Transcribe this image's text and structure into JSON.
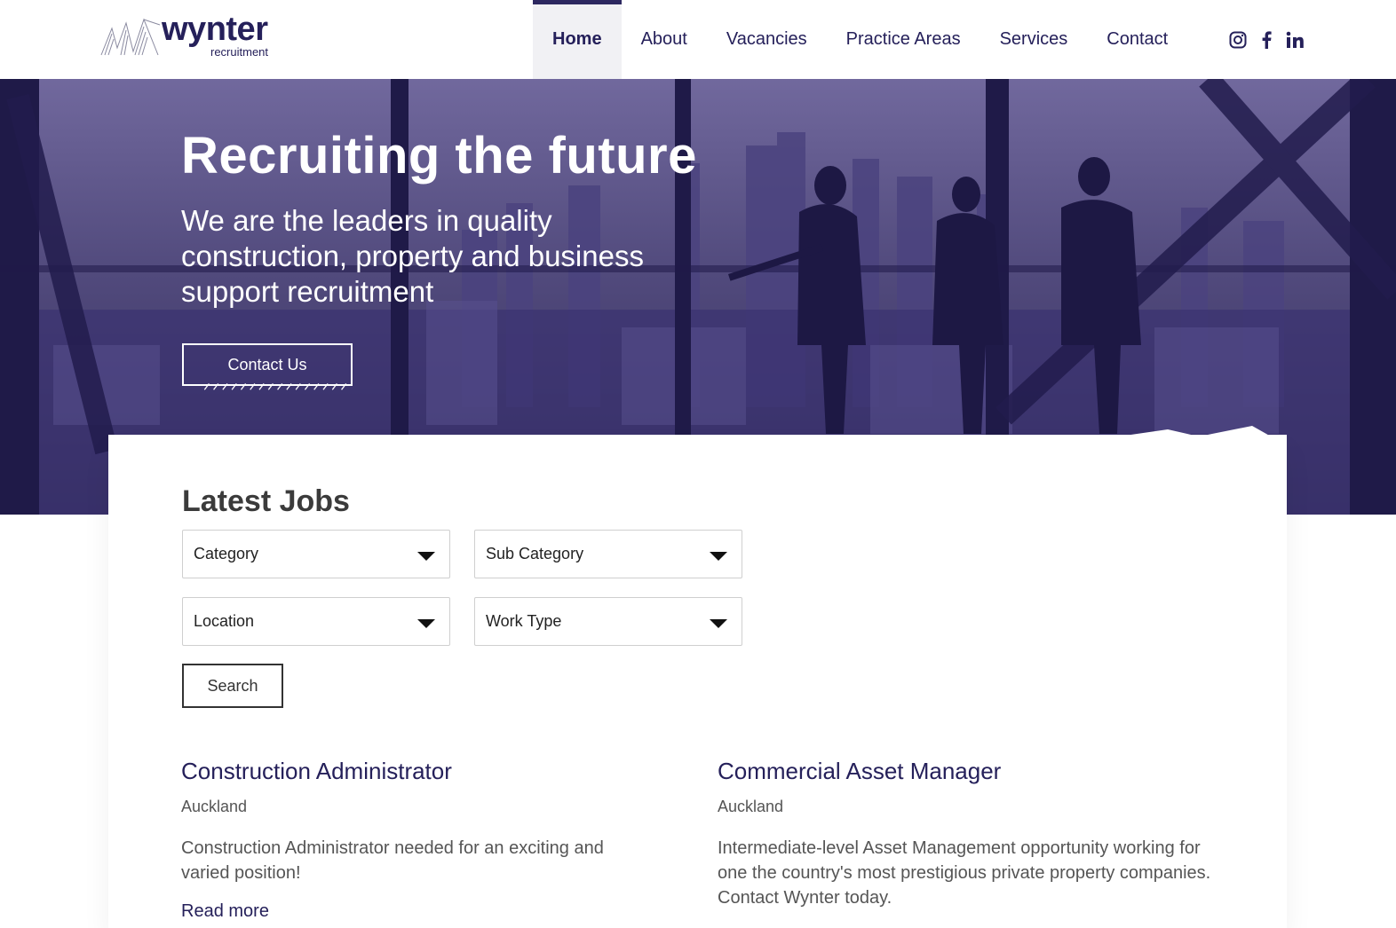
{
  "brand": {
    "name": "wynter",
    "tagline": "recruitment",
    "color": "#25205a"
  },
  "nav": {
    "items": [
      {
        "label": "Home",
        "active": true
      },
      {
        "label": "About",
        "active": false
      },
      {
        "label": "Vacancies",
        "active": false
      },
      {
        "label": "Practice Areas",
        "active": false
      },
      {
        "label": "Services",
        "active": false
      },
      {
        "label": "Contact",
        "active": false
      }
    ],
    "social": [
      "instagram-icon",
      "facebook-icon",
      "linkedin-icon"
    ]
  },
  "hero": {
    "title": "Recruiting the future",
    "subtitle": "We are the leaders in quality construction, property and business support recruitment",
    "button_label": "Contact Us",
    "tint_color": "#3e366e"
  },
  "jobs_search": {
    "title": "Latest Jobs",
    "filters": [
      "Category",
      "Sub Category",
      "Location",
      "Work Type"
    ],
    "search_label": "Search"
  },
  "jobs": [
    {
      "title": "Construction Administrator",
      "location": "Auckland",
      "description": "Construction Administrator needed for an exciting and varied position!",
      "link": "Read more"
    },
    {
      "title": "Commercial Asset Manager",
      "location": "Auckland",
      "description": "Intermediate-level Asset Management opportunity working for one the country's most prestigious private property companies. Contact Wynter today."
    }
  ]
}
